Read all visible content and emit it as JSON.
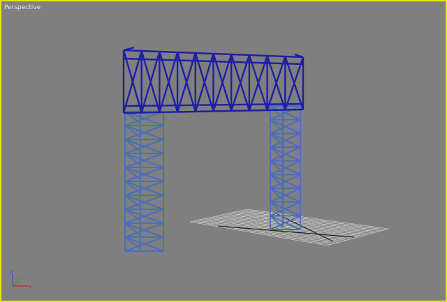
{
  "viewport": {
    "label": "Perspective",
    "background": "#7f7f7f",
    "border_color": "#e6e600"
  },
  "scene": {
    "object": "truss-gantry",
    "beam_color": "#1e1ea8",
    "column_color": "#4a6fb8",
    "grid_color": "#cfcfcf"
  },
  "axis_gizmo": {
    "x_label": "x",
    "y_label": "y",
    "z_label": "z"
  }
}
